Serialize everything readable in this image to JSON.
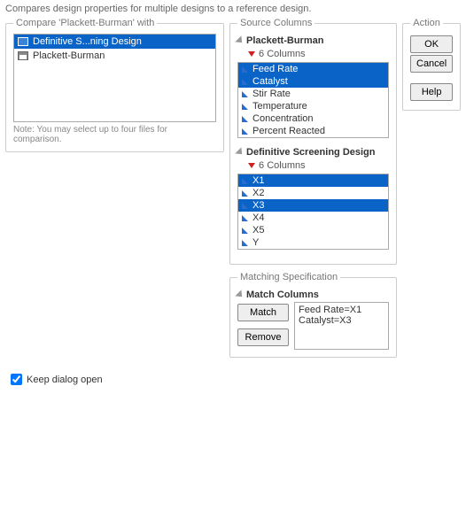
{
  "description": "Compares design properties for multiple designs to a reference design.",
  "compare": {
    "legend": "Compare 'Plackett-Burman' with",
    "items": [
      {
        "label": "Definitive S...ning Design",
        "selected": true
      },
      {
        "label": "Plackett-Burman",
        "selected": false
      }
    ],
    "note": "Note: You may select up to four files for comparison."
  },
  "source": {
    "legend": "Source Columns",
    "groups": [
      {
        "title": "Plackett-Burman",
        "sub": "6 Columns",
        "cols": [
          {
            "label": "Feed Rate",
            "selected": true
          },
          {
            "label": "Catalyst",
            "selected": true
          },
          {
            "label": "Stir Rate",
            "selected": false
          },
          {
            "label": "Temperature",
            "selected": false
          },
          {
            "label": "Concentration",
            "selected": false
          },
          {
            "label": "Percent Reacted",
            "selected": false
          }
        ]
      },
      {
        "title": "Definitive Screening Design",
        "sub": "6 Columns",
        "cols": [
          {
            "label": "X1",
            "selected": true
          },
          {
            "label": "X2",
            "selected": false
          },
          {
            "label": "X3",
            "selected": true
          },
          {
            "label": "X4",
            "selected": false
          },
          {
            "label": "X5",
            "selected": false
          },
          {
            "label": "Y",
            "selected": false
          }
        ]
      }
    ]
  },
  "match": {
    "legend": "Matching Specification",
    "title": "Match Columns",
    "match_btn": "Match",
    "remove_btn": "Remove",
    "entries": [
      "Feed Rate=X1",
      "Catalyst=X3"
    ]
  },
  "action": {
    "legend": "Action",
    "ok": "OK",
    "cancel": "Cancel",
    "help": "Help"
  },
  "keep_open": "Keep dialog open"
}
